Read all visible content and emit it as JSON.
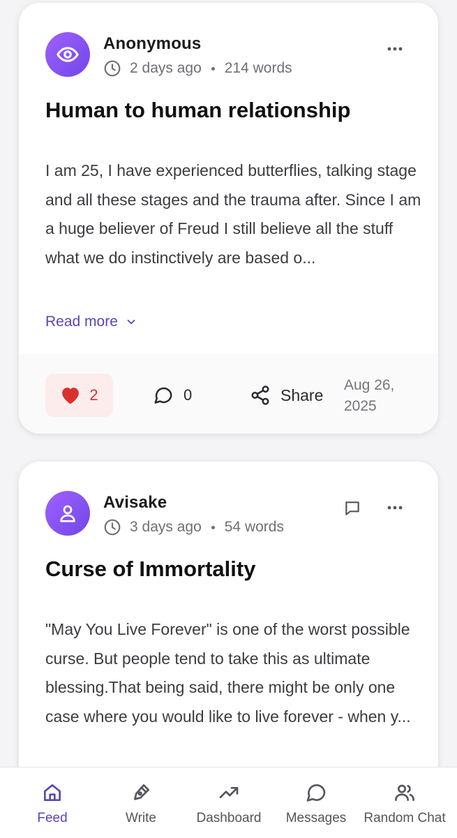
{
  "colors": {
    "accent": "#5b45b8",
    "avatar_gradient_start": "#a061ff",
    "avatar_gradient_end": "#7146e8",
    "like": "#d8322e",
    "like_bg": "#fdecec"
  },
  "posts": [
    {
      "author": "Anonymous",
      "avatar_icon": "eye-icon",
      "time": "2 days ago",
      "words": "214 words",
      "title": "Human to human relationship",
      "excerpt": "I am 25, I have experienced butterflies, talking stage and all these stages and the trauma after. Since I am a huge believer of Freud I still believe all the stuff what we do instinctively are based o...",
      "read_more": "Read more",
      "likes": "2",
      "comments": "0",
      "share_label": "Share",
      "date_line1": "Aug 26,",
      "date_line2": "2025"
    },
    {
      "author": "Avisake",
      "avatar_icon": "user-icon",
      "time": "3 days ago",
      "words": "54 words",
      "title": "Curse of Immortality",
      "excerpt": "\"May You Live Forever\" is one of the worst possible curse. But people tend to take this as ultimate blessing.That being said, there might be only one case where you would like to live forever - when y..."
    }
  ],
  "nav": {
    "items": [
      {
        "label": "Feed",
        "icon": "home-icon",
        "active": true
      },
      {
        "label": "Write",
        "icon": "pen-icon"
      },
      {
        "label": "Dashboard",
        "icon": "trending-icon"
      },
      {
        "label": "Messages",
        "icon": "message-icon"
      },
      {
        "label": "Random Chat",
        "icon": "users-icon"
      }
    ]
  }
}
